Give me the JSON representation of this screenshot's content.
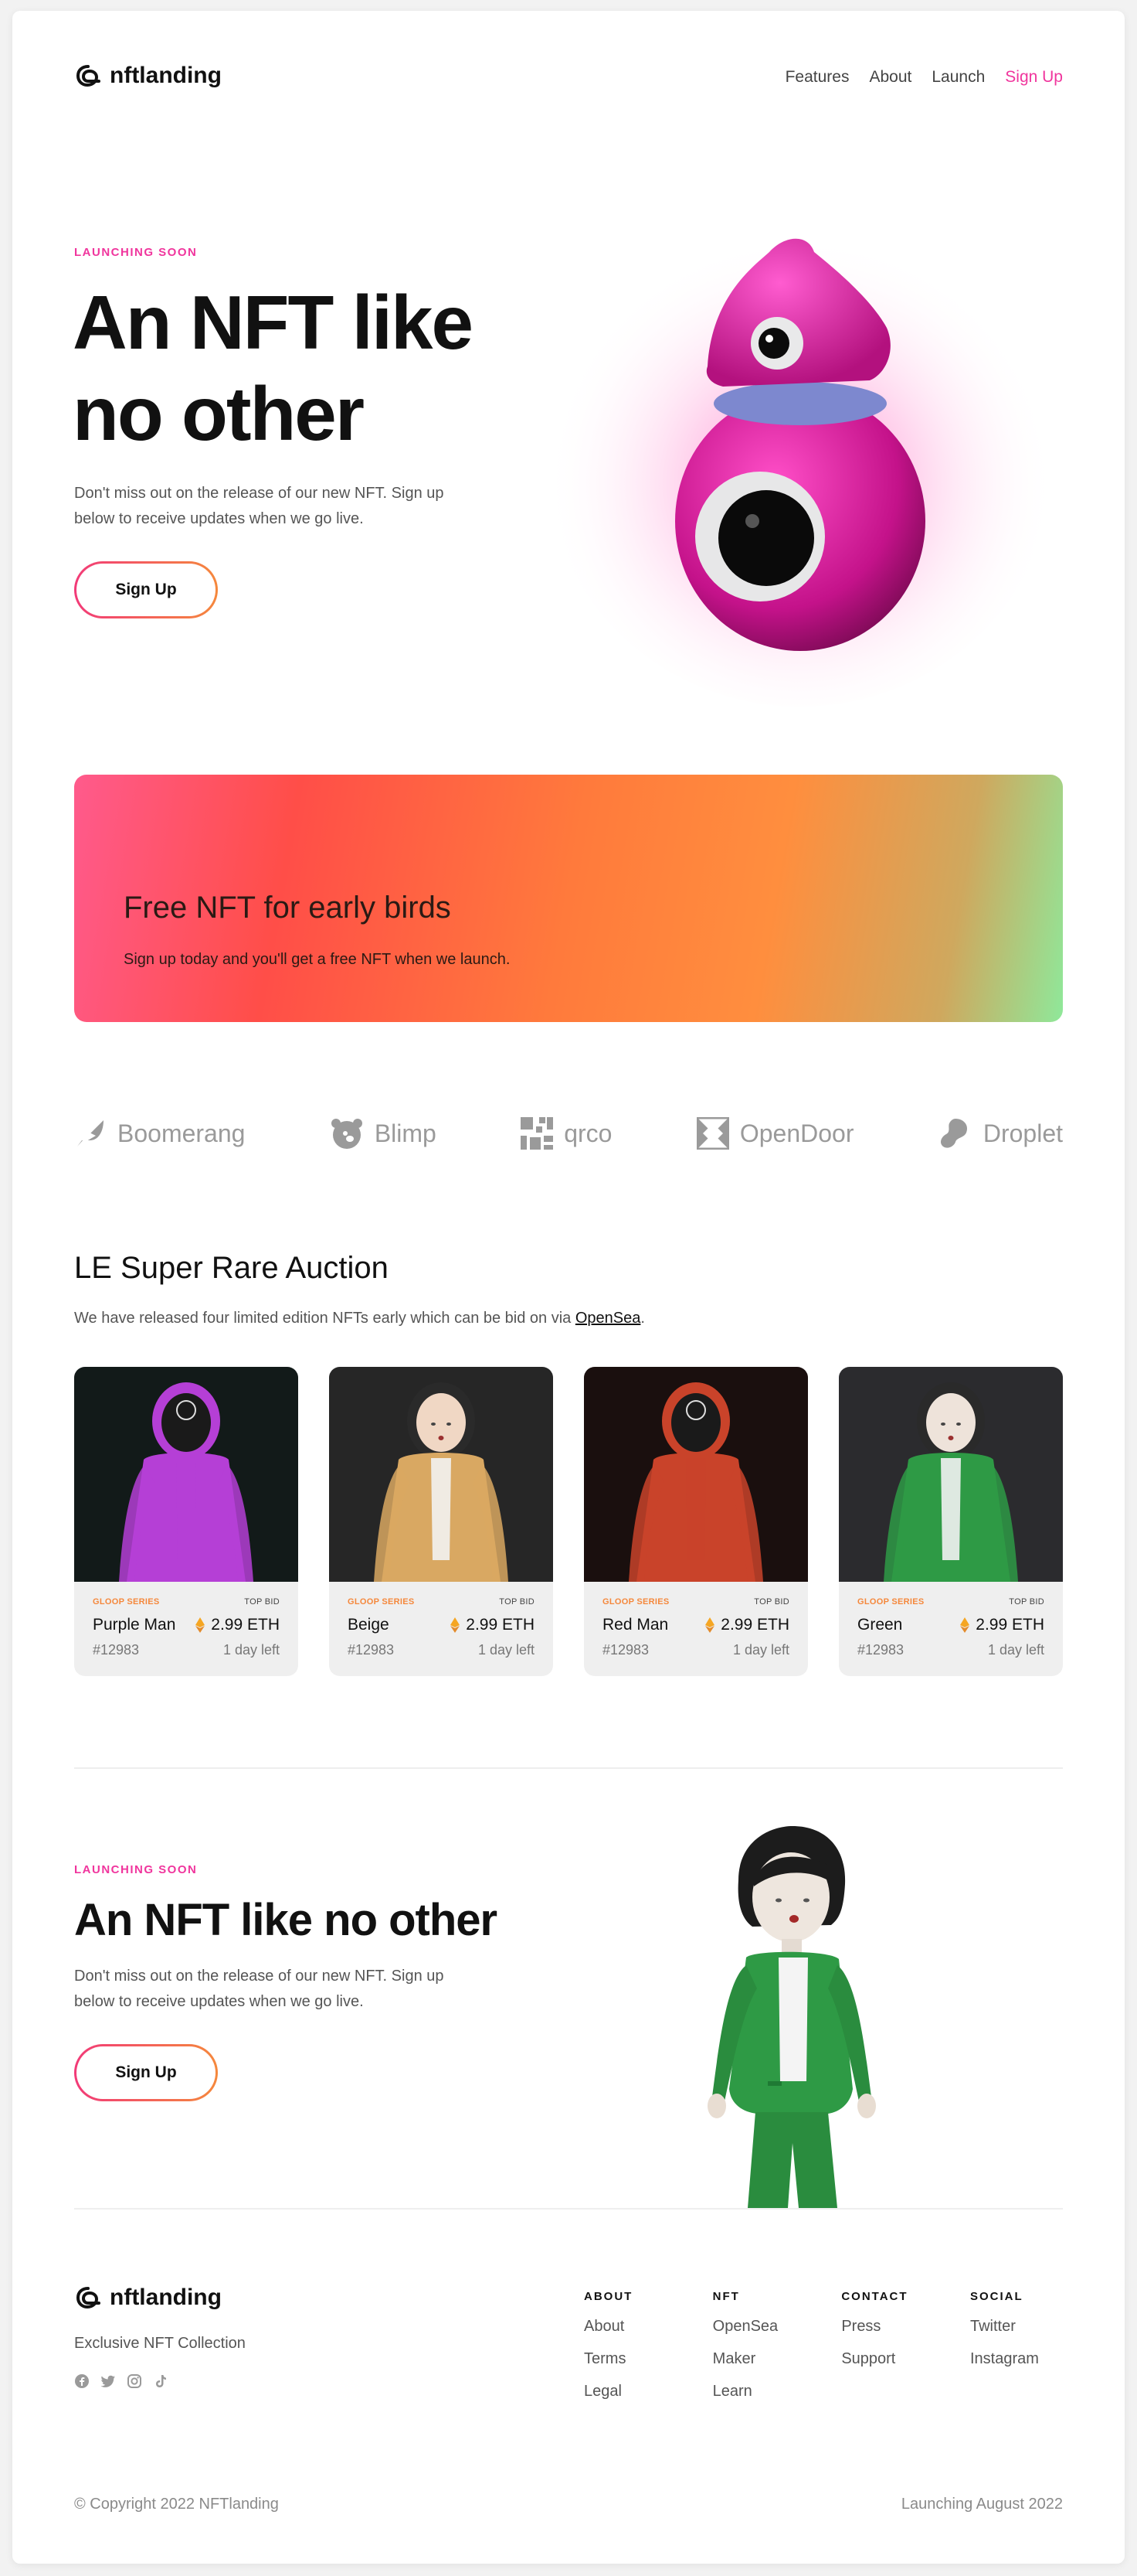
{
  "nav": {
    "logo_text": "nftlanding",
    "links": [
      "Features",
      "About",
      "Launch"
    ],
    "signup": "Sign Up"
  },
  "hero": {
    "eyebrow": "LAUNCHING SOON",
    "title_line1": "An NFT like",
    "title_line2": "no other",
    "desc_line1": "Don't miss out on the release of our new NFT. Sign up",
    "desc_line2": "below to receive updates when we go live.",
    "cta": "Sign Up"
  },
  "banner": {
    "title": "Free NFT for early birds",
    "subtitle": "Sign up today and you'll get a free NFT when we launch."
  },
  "brands": [
    {
      "name": "Boomerang",
      "icon": "boomerang-icon"
    },
    {
      "name": "Blimp",
      "icon": "bear-icon"
    },
    {
      "name": "qrco",
      "icon": "qr-icon"
    },
    {
      "name": "OpenDoor",
      "icon": "door-icon"
    },
    {
      "name": "Droplet",
      "icon": "droplet-icon"
    }
  ],
  "auction": {
    "title": "LE Super Rare Auction",
    "desc": "We have released four limited edition NFTs early which can be bid on via",
    "link": "OpenSea",
    "period": ".",
    "cards": [
      {
        "series": "GLOOP SERIES",
        "bid_label": "TOP BID",
        "name": "Purple Man",
        "price": "2.99 ETH",
        "id": "#12983",
        "time": "1 day left",
        "bg": "#121a19",
        "body": "#b53fd6",
        "head": "#1a1a1a"
      },
      {
        "series": "GLOOP SERIES",
        "bid_label": "TOP BID",
        "name": "Beige",
        "price": "2.99 ETH",
        "id": "#12983",
        "time": "1 day left",
        "bg": "#262626",
        "body": "#d9a862",
        "head": "#f0d7c4"
      },
      {
        "series": "GLOOP SERIES",
        "bid_label": "TOP BID",
        "name": "Red Man",
        "price": "2.99 ETH",
        "id": "#12983",
        "time": "1 day left",
        "bg": "#1a0f0e",
        "body": "#c9432a",
        "head": "#1a1a1a"
      },
      {
        "series": "GLOOP SERIES",
        "bid_label": "TOP BID",
        "name": "Green",
        "price": "2.99 ETH",
        "id": "#12983",
        "time": "1 day left",
        "bg": "#2b2b2e",
        "body": "#2e9a45",
        "head": "#eee3da"
      }
    ]
  },
  "cta2": {
    "eyebrow": "LAUNCHING SOON",
    "title": "An NFT like no other",
    "desc_line1": "Don't miss out on the release of our new NFT. Sign up",
    "desc_line2": "below to receive updates when we go live.",
    "cta": "Sign Up"
  },
  "footer": {
    "logo_text": "nftlanding",
    "tagline": "Exclusive NFT Collection",
    "socials": [
      "facebook-icon",
      "twitter-icon",
      "instagram-icon",
      "tiktok-icon"
    ],
    "columns": [
      {
        "heading": "ABOUT",
        "links": [
          "About",
          "Terms",
          "Legal"
        ]
      },
      {
        "heading": "NFT",
        "links": [
          "OpenSea",
          "Maker",
          "Learn"
        ]
      },
      {
        "heading": "CONTACT",
        "links": [
          "Press",
          "Support"
        ]
      },
      {
        "heading": "SOCIAL",
        "links": [
          "Twitter",
          "Instagram"
        ]
      }
    ],
    "copyright": "© Copyright 2022 NFTlanding",
    "launch": "Launching August 2022"
  },
  "colors": {
    "accent_pink": "#f0359d",
    "accent_orange": "#f5883c",
    "text": "#111111",
    "muted": "#777777"
  }
}
